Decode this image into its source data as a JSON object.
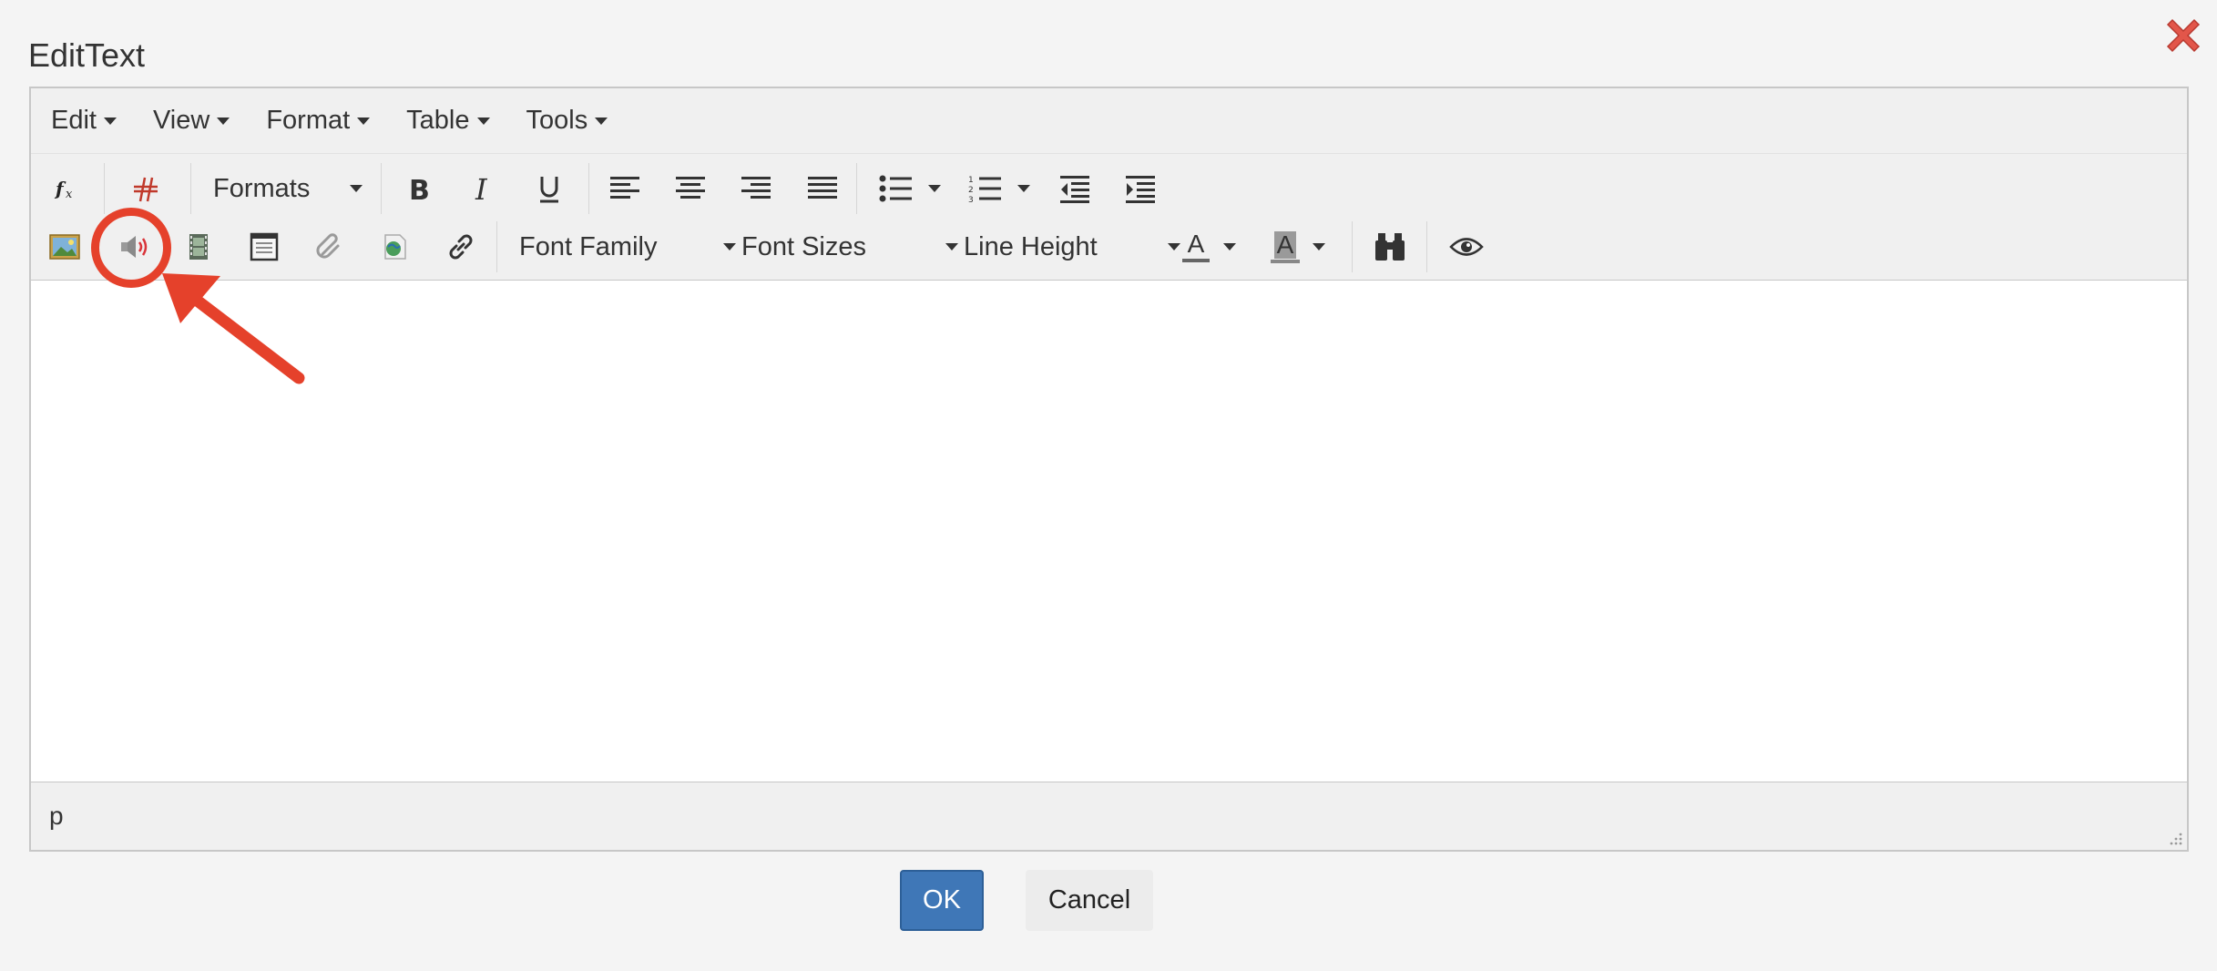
{
  "dialog": {
    "title": "EditText",
    "ok_label": "OK",
    "cancel_label": "Cancel"
  },
  "menubar": {
    "items": [
      {
        "label": "Edit"
      },
      {
        "label": "View"
      },
      {
        "label": "Format"
      },
      {
        "label": "Table"
      },
      {
        "label": "Tools"
      }
    ]
  },
  "toolbar": {
    "formats_label": "Formats",
    "font_family_label": "Font Family",
    "font_sizes_label": "Font Sizes",
    "line_height_label": "Line Height",
    "text_color_glyph": "A",
    "background_color_glyph": "A"
  },
  "statusbar": {
    "path": "p"
  },
  "icons": [
    "formula-icon",
    "strikethrough-icon",
    "bold-icon",
    "italic-icon",
    "underline-icon",
    "align-left-icon",
    "align-center-icon",
    "align-right-icon",
    "align-justify-icon",
    "bullet-list-icon",
    "numbered-list-icon",
    "outdent-icon",
    "indent-icon",
    "image-icon",
    "audio-icon",
    "video-icon",
    "document-icon",
    "attachment-icon",
    "web-page-icon",
    "link-icon",
    "find-icon",
    "preview-icon",
    "close-icon"
  ],
  "colors": {
    "ok_button": "#3f77b7",
    "highlight": "#e5412b"
  }
}
